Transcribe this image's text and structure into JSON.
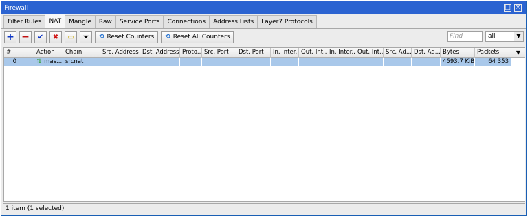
{
  "window": {
    "title": "Firewall"
  },
  "tabs": [
    "Filter Rules",
    "NAT",
    "Mangle",
    "Raw",
    "Service Ports",
    "Connections",
    "Address Lists",
    "Layer7 Protocols"
  ],
  "toolbar": {
    "reset_counters": "Reset Counters",
    "reset_all_counters": "Reset All Counters",
    "find_placeholder": "Find",
    "filter_value": "all"
  },
  "table": {
    "columns": [
      "#",
      "",
      "Action",
      "Chain",
      "Src. Address",
      "Dst. Address",
      "Proto...",
      "Src. Port",
      "Dst. Port",
      "In. Inter...",
      "Out. Int...",
      "In. Inter...",
      "Out. Int...",
      "Src. Ad...",
      "Dst. Ad...",
      "Bytes",
      "Packets"
    ],
    "rows": [
      {
        "num": "0",
        "action": "mas...",
        "chain": "srcnat",
        "bytes": "4593.7 KiB",
        "packets": "64 353"
      }
    ]
  },
  "status": "1 item (1 selected)"
}
